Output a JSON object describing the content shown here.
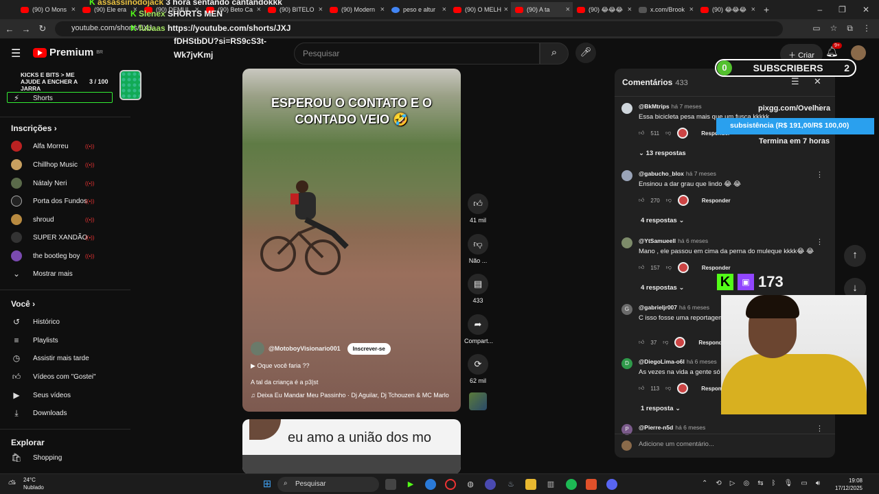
{
  "browser": {
    "tabs": [
      "(90) O Mons",
      "(90) Ele era",
      "(90) DEMUL",
      "(90) Beto Ca",
      "(90) BITELO",
      "(90) Modern",
      "peso e altur",
      "(90) O MELH",
      "(90) A ta",
      "(90) 😂😂😂",
      "x.com/Brook",
      "(90) 😂😂😂"
    ],
    "new_tab": "+",
    "url": "youtube.com/shorts/JXJ..."
  },
  "youtube": {
    "logo_text": "Premium",
    "region": "BR",
    "search_placeholder": "Pesquisar",
    "create_label": "Criar",
    "notif_count": "9+"
  },
  "sidebar": {
    "shorts_label": "Shorts",
    "subs_heading": "Inscrições",
    "channels": [
      "Alfa Morreu",
      "Chillhop Music",
      "Nátaly Neri",
      "Porta dos Fundos",
      "shroud",
      "SUPER XANDÃO",
      "the bootleg boy"
    ],
    "show_more": "Mostrar mais",
    "you_heading": "Você",
    "you_items": [
      "Histórico",
      "Playlists",
      "Assistir mais tarde",
      "Vídeos com \"Gostei\"",
      "Seus vídeos",
      "Downloads"
    ],
    "explore_heading": "Explorar",
    "explore_items": [
      "Shopping"
    ]
  },
  "short": {
    "caption_line1": "ESPEROU O CONTATO E O",
    "caption_line2": "CONTADO VEIO 🤣",
    "channel": "@MotoboyVisionario001",
    "subscribe": "Inscrever-se",
    "question": "Oque você faria ??",
    "description": "A tal da criança é a p3|st",
    "music": "Deixa Eu Mandar Meu Passinho · Dj Aguilar, Dj Tchouzen & MC Marlo",
    "likes": "41 mil",
    "dislike": "Não ...",
    "comments": "433",
    "share": "Compart...",
    "remix": "62 mil",
    "next_caption": "eu amo a união dos mo"
  },
  "comments_panel": {
    "title": "Comentários",
    "count": "433",
    "items": [
      {
        "user": "@BkMtrips",
        "time": "há 7 meses",
        "text": "Essa bicicleta pesa mais que um fusca kkkkk",
        "likes": "511",
        "reply": "Responder",
        "replies": "13 respostas",
        "avatar_color": "#cfd6dc"
      },
      {
        "user": "@gabucho_blox",
        "time": "há 7 meses",
        "text": "Ensinou a dar grau que lindo 😂 😂",
        "likes": "270",
        "reply": "Responder",
        "replies": "4 respostas",
        "avatar_color": "#9aa4b8"
      },
      {
        "user": "@YtSamueell",
        "time": "há 6 meses",
        "text": "Mano , ele passou em cima da perna do muleque kkkk😂 😂",
        "likes": "157",
        "reply": "Responder",
        "replies": "4 respostas",
        "avatar_color": "#7d8b6a"
      },
      {
        "user": "@gabrieljr007",
        "time": "há 6 meses",
        "text": "C isso fosse uma  reportagem seria de outro ciclista 😂 😂 😂",
        "likes": "37",
        "reply": "Responder",
        "replies": "",
        "avatar_color": "#6b6b6b"
      },
      {
        "user": "@DiegoLima-o6l",
        "time": "há 6 meses",
        "text": "As vezes na vida a gente só precisa d",
        "likes": "113",
        "reply": "Responder",
        "replies": "1 resposta",
        "avatar_color": "#2f9a4a"
      },
      {
        "user": "@Pierre-n5d",
        "time": "há 6 meses",
        "text": "",
        "likes": "",
        "reply": "",
        "replies": "",
        "avatar_color": "#7a5a8a"
      }
    ],
    "letters": {
      "g": "G",
      "d": "D",
      "p": "P"
    },
    "add_placeholder": "Adicione um comentário..."
  },
  "overlay": {
    "kick_user1": "assassinodojack",
    "kick_msg1": "3 hora sentando cantandokkk",
    "kick_user2": "Slenex",
    "kick_msg2": "SHORTS MEN",
    "kick_user3": "fubaas",
    "kick_msg3": "https://youtube.com/shorts/JXJ",
    "kick_msg3b": "fDHStbDU?si=RS9cS3t-",
    "kick_msg3c": "Wk7jvKmj",
    "goal_title": "KICKS E BITS > ME AJUDE A ENCHER A JARRA",
    "goal_progress": "3 / 100",
    "subs_left": "0",
    "subs_label": "SUBSCRIBERS",
    "subs_right": "2",
    "pixgg": "pixgg.com/Ovelhera",
    "sub_goal": "subsistência (R$ 191,00/R$ 100,00)",
    "ends": "Termina em 7 horas",
    "viewers": "173"
  },
  "taskbar": {
    "temp": "24°C",
    "condition": "Nublado",
    "search": "Pesquisar",
    "time": "19:08",
    "date": "17/12/2025"
  }
}
